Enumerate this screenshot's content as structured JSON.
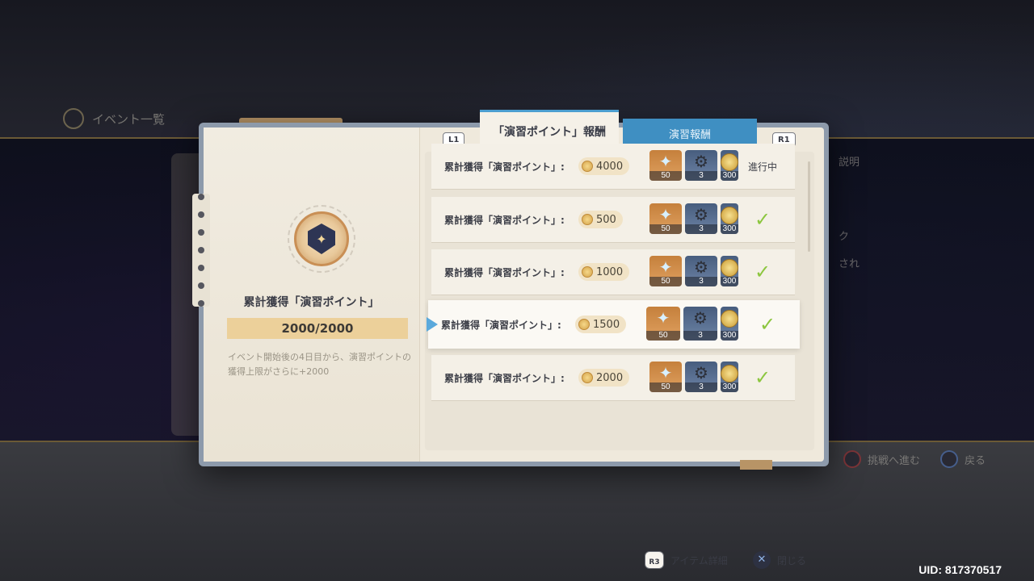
{
  "background": {
    "title": "イベント一覧",
    "right_text_1": "説明",
    "right_text_2": "ク",
    "right_text_3": "され",
    "hint_advance": "挑戦へ進む",
    "hint_back": "戻る"
  },
  "uid": "UID: 817370517",
  "modal": {
    "key_left": "L1",
    "key_right": "R1",
    "tab_active": "「演習ポイント」報酬",
    "tab_inactive": "演習報酬",
    "left": {
      "title": "累計獲得「演習ポイント」",
      "progress": "2000/2000",
      "description": "イベント開始後の4日目から、演習ポイントの獲得上限がさらに+2000"
    },
    "rows": [
      {
        "label": "累計獲得「演習ポイント」:",
        "points": "4000",
        "rewards": [
          "50",
          "3",
          "300"
        ],
        "status": "進行中",
        "completed": false
      },
      {
        "label": "累計獲得「演習ポイント」:",
        "points": "500",
        "rewards": [
          "50",
          "3",
          "300"
        ],
        "status": "",
        "completed": true
      },
      {
        "label": "累計獲得「演習ポイント」:",
        "points": "1000",
        "rewards": [
          "50",
          "3",
          "300"
        ],
        "status": "",
        "completed": true
      },
      {
        "label": "累計獲得「演習ポイント」:",
        "points": "1500",
        "rewards": [
          "50",
          "3",
          "300"
        ],
        "status": "",
        "completed": true
      },
      {
        "label": "累計獲得「演習ポイント」:",
        "points": "2000",
        "rewards": [
          "50",
          "3",
          "300"
        ],
        "status": "",
        "completed": true
      }
    ],
    "footer": {
      "item_detail_key": "R3",
      "item_detail": "アイテム詳細",
      "close_key": "✕",
      "close": "閉じる"
    }
  },
  "icons": {
    "reward_1": "primogem-star-icon",
    "reward_2": "hydraulic-item-icon",
    "reward_3": "mora-coin-icon",
    "check": "checkmark-icon"
  },
  "colors": {
    "accent_blue": "#3f8fc2",
    "progress_fill": "#ecd09a",
    "check_green": "#8cc63f"
  }
}
